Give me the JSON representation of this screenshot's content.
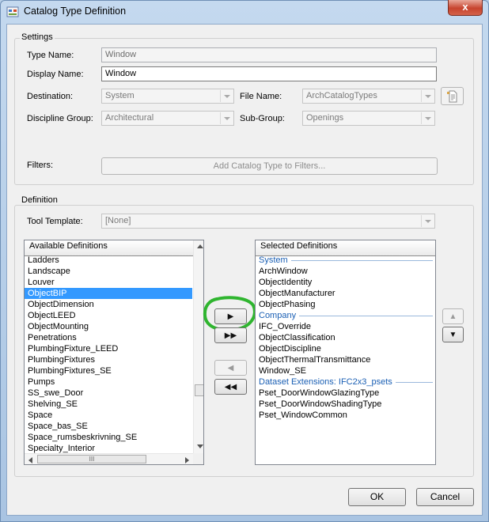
{
  "window": {
    "title": "Catalog Type Definition",
    "close_label": "x"
  },
  "settings": {
    "group_label": "Settings",
    "type_name": {
      "label": "Type Name:",
      "value": "Window"
    },
    "display_name": {
      "label": "Display Name:",
      "value": "Window"
    },
    "destination": {
      "label": "Destination:",
      "value": "System"
    },
    "file_name": {
      "label": "File Name:",
      "value": "ArchCatalogTypes"
    },
    "discipline_group": {
      "label": "Discipline Group:",
      "value": "Architectural"
    },
    "sub_group": {
      "label": "Sub-Group:",
      "value": "Openings"
    },
    "filters": {
      "label": "Filters:",
      "button_label": "Add Catalog Type to Filters..."
    }
  },
  "definition": {
    "group_label": "Definition",
    "tool_template": {
      "label": "Tool Template:",
      "value": "[None]"
    },
    "available": {
      "header": "Available Definitions",
      "items": [
        "Ladders",
        "Landscape",
        "Louver",
        "ObjectBIP",
        "ObjectDimension",
        "ObjectLEED",
        "ObjectMounting",
        "Penetrations",
        "PlumbingFixture_LEED",
        "PlumbingFixtures",
        "PlumbingFixtures_SE",
        "Pumps",
        "SS_swe_Door",
        "Shelving_SE",
        "Space",
        "Space_bas_SE",
        "Space_rumsbeskrivning_SE",
        "Specialty_Interior"
      ],
      "selected_item": "ObjectBIP"
    },
    "selected": {
      "header": "Selected Definitions",
      "groups": [
        {
          "category": "System",
          "items": [
            "ArchWindow",
            "ObjectIdentity",
            "ObjectManufacturer",
            "ObjectPhasing"
          ]
        },
        {
          "category": "Company",
          "items": [
            "IFC_Override",
            "ObjectClassification",
            "ObjectDiscipline",
            "ObjectThermalTransmittance",
            "Window_SE"
          ]
        },
        {
          "category": "Dataset Extensions: IFC2x3_psets",
          "items": [
            "Pset_DoorWindowGlazingType",
            "Pset_DoorWindowShadingType",
            "Pset_WindowCommon"
          ]
        }
      ]
    },
    "transfer_buttons": {
      "add": "▶",
      "add_all": "▶▶",
      "remove": "◀",
      "remove_all": "◀◀"
    },
    "order_buttons": {
      "up": "▲",
      "down": "▼"
    },
    "scroll_thumb": "III",
    "highlight_color": "#2fb52f"
  },
  "footer": {
    "ok_label": "OK",
    "cancel_label": "Cancel"
  },
  "colors": {
    "selection": "#3399ff",
    "category_text": "#1a5fb4"
  }
}
